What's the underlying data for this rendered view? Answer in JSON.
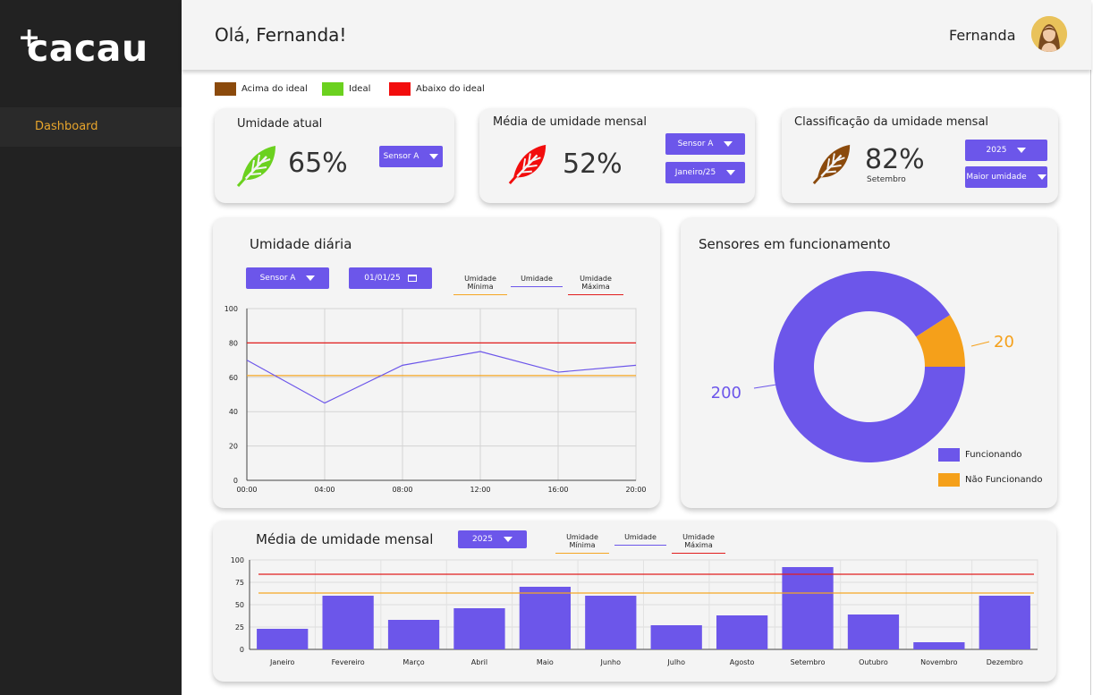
{
  "app": {
    "logo_plus": "+",
    "logo_word": "cacau"
  },
  "sidebar": {
    "items": [
      {
        "label": "Dashboard"
      }
    ]
  },
  "header": {
    "greeting": "Olá, Fernanda!",
    "user_name": "Fernanda"
  },
  "legend": {
    "items": [
      {
        "label": "Acima do ideal",
        "color": "#8b4a0c"
      },
      {
        "label": "Ideal",
        "color": "#6bd11f"
      },
      {
        "label": "Abaixo do ideal",
        "color": "#f20d0d"
      }
    ]
  },
  "cards": {
    "current": {
      "title": "Umidade atual",
      "value": "65%",
      "sensor": "Sensor A",
      "leaf_color": "#6bd11f",
      "leaf_icon": "leaf-icon"
    },
    "monthly_avg": {
      "title": "Média de umidade mensal",
      "value": "52%",
      "sensor": "Sensor A",
      "month": "Janeiro/25",
      "leaf_color": "#f20d0d",
      "leaf_icon": "leaf-icon"
    },
    "classification": {
      "title": "Classificação da umidade mensal",
      "value": "82%",
      "month_label": "Setembro",
      "year": "2025",
      "order": "Maior umidade",
      "leaf_color": "#8b4a0c",
      "leaf_icon": "leaf-icon"
    }
  },
  "daily": {
    "title": "Umidade diária",
    "sensor": "Sensor A",
    "date": "01/01/25",
    "legend": [
      {
        "label": "Umidade Mínima",
        "color": "#f5a623"
      },
      {
        "label": "Umidade",
        "color": "#6c56ea"
      },
      {
        "label": "Umidade Máxima",
        "color": "#e11d1d"
      }
    ]
  },
  "sensors": {
    "title": "Sensores em funcionamento",
    "legend": [
      {
        "label": "Funcionando",
        "color": "#6c56ea"
      },
      {
        "label": "Não Funcionando",
        "color": "#f5a01a"
      }
    ]
  },
  "monthly": {
    "title": "Média de umidade mensal",
    "year": "2025",
    "legend": [
      {
        "label": "Umidade Mínima",
        "color": "#f5a623"
      },
      {
        "label": "Umidade",
        "color": "#6c56ea"
      },
      {
        "label": "Umidade Máxima",
        "color": "#e11d1d"
      }
    ]
  },
  "chart_data": [
    {
      "type": "line",
      "x": [
        "00:00",
        "04:00",
        "08:00",
        "12:00",
        "16:00",
        "20:00"
      ],
      "series": [
        {
          "name": "Umidade",
          "values": [
            70,
            45,
            67,
            75,
            63,
            67
          ],
          "color": "#6c56ea"
        },
        {
          "name": "Umidade Mínima",
          "values": [
            61,
            61,
            61,
            61,
            61,
            61
          ],
          "color": "#f5a623"
        },
        {
          "name": "Umidade Máxima",
          "values": [
            80,
            80,
            80,
            80,
            80,
            80
          ],
          "color": "#e11d1d"
        }
      ],
      "yticks": [
        0,
        20,
        40,
        60,
        80,
        100
      ],
      "ylim": [
        0,
        100
      ],
      "grid": true
    },
    {
      "type": "pie",
      "donut": true,
      "slices": [
        {
          "label": "Funcionando",
          "value": 200,
          "color": "#6c56ea"
        },
        {
          "label": "Não Funcionando",
          "value": 20,
          "color": "#f5a01a"
        }
      ],
      "legend": "bottom-right"
    },
    {
      "type": "bar",
      "categories": [
        "Janeiro",
        "Fevereiro",
        "Março",
        "Abril",
        "Maio",
        "Junho",
        "Julho",
        "Agosto",
        "Setembro",
        "Outubro",
        "Novembro",
        "Dezembro"
      ],
      "values": [
        23,
        60,
        33,
        46,
        70,
        60,
        27,
        38,
        92,
        39,
        8,
        60
      ],
      "lines": [
        {
          "name": "Umidade Mínima",
          "value": 63,
          "color": "#f5a623"
        },
        {
          "name": "Umidade Máxima",
          "value": 84,
          "color": "#e11d1d"
        }
      ],
      "yticks": [
        0,
        25,
        50,
        75,
        100
      ],
      "ylim": [
        0,
        100
      ],
      "bar_color": "#6c56ea",
      "grid": true
    }
  ]
}
